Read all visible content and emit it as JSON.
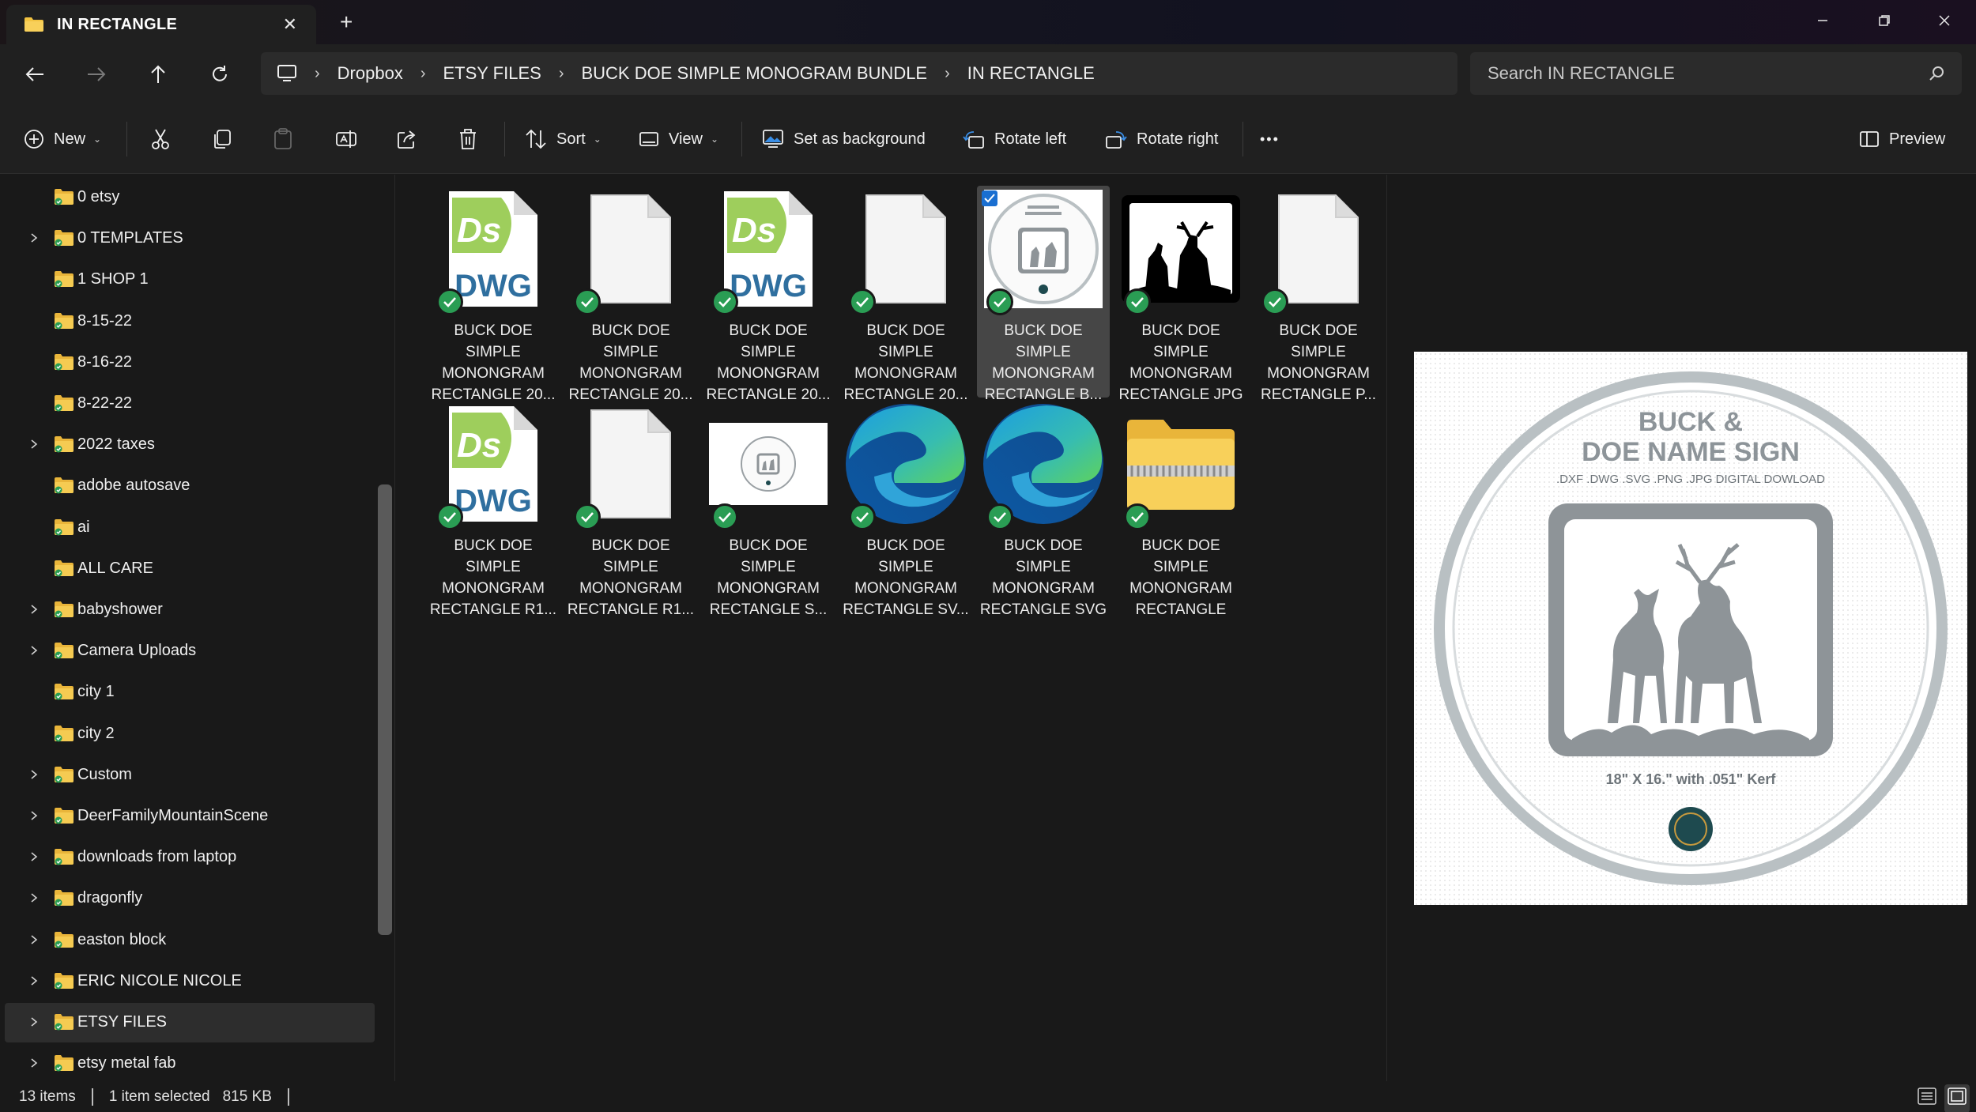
{
  "window": {
    "tab_title": "IN RECTANGLE",
    "tab_close": "✕",
    "new_tab": "+"
  },
  "breadcrumb": [
    "Dropbox",
    "ETSY FILES",
    "BUCK DOE SIMPLE MONOGRAM BUNDLE",
    "IN RECTANGLE"
  ],
  "search": {
    "placeholder": "Search IN RECTANGLE"
  },
  "toolbar": {
    "new_label": "New",
    "sort_label": "Sort",
    "view_label": "View",
    "set_background_label": "Set as background",
    "rotate_left_label": "Rotate left",
    "rotate_right_label": "Rotate right",
    "more_label": "•••",
    "preview_label": "Preview"
  },
  "sidebar": {
    "items": [
      {
        "label": "0 etsy",
        "expandable": false
      },
      {
        "label": "0 TEMPLATES",
        "expandable": true
      },
      {
        "label": "1 SHOP 1",
        "expandable": false
      },
      {
        "label": "8-15-22",
        "expandable": false
      },
      {
        "label": "8-16-22",
        "expandable": false
      },
      {
        "label": "8-22-22",
        "expandable": false
      },
      {
        "label": "2022 taxes",
        "expandable": true
      },
      {
        "label": "adobe autosave",
        "expandable": false
      },
      {
        "label": "ai",
        "expandable": false
      },
      {
        "label": "ALL CARE",
        "expandable": false
      },
      {
        "label": "babyshower",
        "expandable": true
      },
      {
        "label": "Camera Uploads",
        "expandable": true
      },
      {
        "label": "city 1",
        "expandable": false
      },
      {
        "label": "city 2",
        "expandable": false
      },
      {
        "label": "Custom",
        "expandable": true
      },
      {
        "label": "DeerFamilyMountainScene",
        "expandable": true
      },
      {
        "label": "downloads from laptop",
        "expandable": true
      },
      {
        "label": "dragonfly",
        "expandable": true
      },
      {
        "label": "easton block",
        "expandable": true
      },
      {
        "label": "ERIC NICOLE NICOLE",
        "expandable": true
      },
      {
        "label": "ETSY FILES",
        "expandable": true,
        "selected": true
      },
      {
        "label": "etsy metal fab",
        "expandable": true
      }
    ]
  },
  "files": [
    {
      "lines": [
        "BUCK DOE",
        "SIMPLE",
        "MONONGRAM",
        "RECTANGLE 20..."
      ],
      "icon": "dwg-icon"
    },
    {
      "lines": [
        "BUCK DOE",
        "SIMPLE",
        "MONONGRAM",
        "RECTANGLE 20..."
      ],
      "icon": "blank-file-icon"
    },
    {
      "lines": [
        "BUCK DOE",
        "SIMPLE",
        "MONONGRAM",
        "RECTANGLE 20..."
      ],
      "icon": "dwg-icon"
    },
    {
      "lines": [
        "BUCK DOE",
        "SIMPLE",
        "MONONGRAM",
        "RECTANGLE 20..."
      ],
      "icon": "blank-file-icon"
    },
    {
      "lines": [
        "BUCK DOE",
        "SIMPLE",
        "MONONGRAM",
        "RECTANGLE B..."
      ],
      "icon": "sign-thumbnail",
      "selected": true
    },
    {
      "lines": [
        "BUCK DOE",
        "SIMPLE",
        "MONONGRAM",
        "RECTANGLE JPG"
      ],
      "icon": "deer-silhouette-thumbnail"
    },
    {
      "lines": [
        "BUCK DOE",
        "SIMPLE",
        "MONONGRAM",
        "RECTANGLE P..."
      ],
      "icon": "blank-file-icon"
    },
    {
      "lines": [
        "BUCK DOE",
        "SIMPLE",
        "MONONGRAM",
        "RECTANGLE R1..."
      ],
      "icon": "dwg-icon"
    },
    {
      "lines": [
        "BUCK DOE",
        "SIMPLE",
        "MONONGRAM",
        "RECTANGLE R1..."
      ],
      "icon": "blank-file-icon"
    },
    {
      "lines": [
        "BUCK DOE",
        "SIMPLE",
        "MONONGRAM",
        "RECTANGLE S..."
      ],
      "icon": "wide-sign-thumbnail",
      "nosync": false
    },
    {
      "lines": [
        "BUCK DOE",
        "SIMPLE",
        "MONONGRAM",
        "RECTANGLE SV..."
      ],
      "icon": "edge-icon"
    },
    {
      "lines": [
        "BUCK DOE",
        "SIMPLE",
        "MONONGRAM",
        "RECTANGLE SVG"
      ],
      "icon": "edge-icon"
    },
    {
      "lines": [
        "BUCK DOE",
        "SIMPLE",
        "MONONGRAM",
        "RECTANGLE"
      ],
      "icon": "zip-folder-icon"
    }
  ],
  "dwg_badge_text": "DWG",
  "dwg_ds_text": "Ds",
  "preview": {
    "title_line1": "BUCK &",
    "title_line2": "DOE NAME SIGN",
    "formats": ".DXF .DWG .SVG .PNG .JPG DIGITAL DOWLOAD",
    "size_text": "18\" X 16.\" with .051\" Kerf"
  },
  "status": {
    "item_count": "13 items",
    "selection": "1 item selected",
    "size": "815 KB"
  },
  "colors": {
    "accent": "#1a6fd1",
    "sync_green": "#2a9d54",
    "folder_yellow": "#f3c441"
  }
}
